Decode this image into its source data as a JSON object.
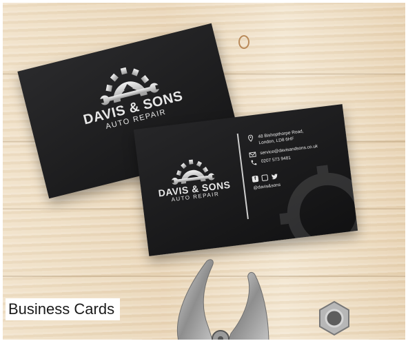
{
  "caption": "Business Cards",
  "card_back": {
    "brand": "DAVIS & SONS",
    "subtitle": "AUTO REPAIR"
  },
  "card_front": {
    "brand": "DAVIS & SONS",
    "subtitle": "AUTO REPAIR",
    "address_line1": "48 Bishopthorpe Road,",
    "address_line2": "London, LD8 6HF",
    "email": "service@davisandsons.co.uk",
    "phone": "0207 573 9481",
    "social_handle": "@davis&sons",
    "social_icons": [
      "facebook-icon",
      "instagram-icon",
      "twitter-icon"
    ]
  },
  "colors": {
    "card": "#1d1d1f",
    "logo_silver": "#d6d6d6",
    "wood": "#ead6b8"
  }
}
